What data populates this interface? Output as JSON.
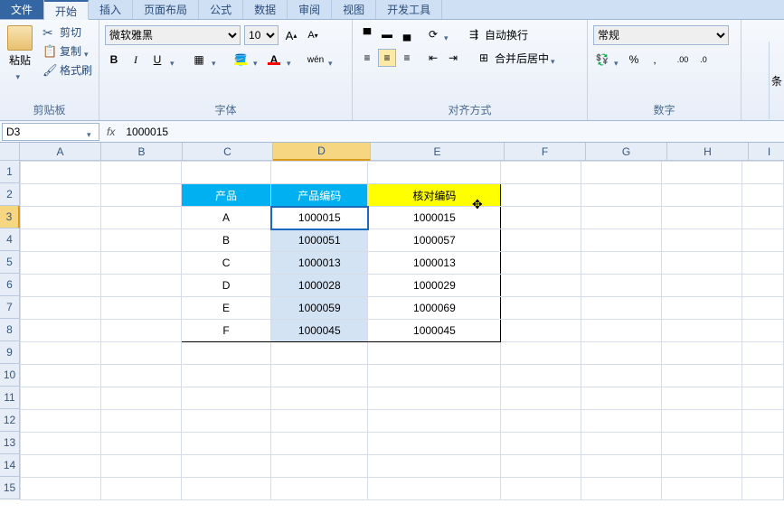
{
  "menu": {
    "file": "文件",
    "home": "开始",
    "insert": "插入",
    "layout": "页面布局",
    "formula": "公式",
    "data": "数据",
    "review": "审阅",
    "view": "视图",
    "dev": "开发工具"
  },
  "ribbon": {
    "clipboard": {
      "paste": "粘贴",
      "cut": "剪切",
      "copy": "复制",
      "format": "格式刷",
      "title": "剪贴板"
    },
    "font": {
      "name": "微软雅黑",
      "size": "10",
      "title": "字体"
    },
    "align": {
      "wrap": "自动换行",
      "merge": "合并后居中",
      "title": "对齐方式"
    },
    "number": {
      "format": "常规",
      "title": "数字"
    },
    "far_right": "条"
  },
  "formula_bar": {
    "namebox": "D3",
    "fx": "fx",
    "value": "1000015"
  },
  "cols": [
    "A",
    "B",
    "C",
    "D",
    "E",
    "F",
    "G",
    "H",
    "I"
  ],
  "rows": [
    "1",
    "2",
    "3",
    "4",
    "5",
    "6",
    "7",
    "8",
    "9",
    "10",
    "11",
    "12",
    "13",
    "14",
    "15"
  ],
  "active_cell": "D3",
  "table": {
    "headers": {
      "c": "产品",
      "d": "产品编码",
      "e": "核对编码"
    },
    "rows": [
      {
        "c": "A",
        "d": "1000015",
        "e": "1000015",
        "d_highlight": false
      },
      {
        "c": "B",
        "d": "1000051",
        "e": "1000057",
        "d_highlight": true
      },
      {
        "c": "C",
        "d": "1000013",
        "e": "1000013",
        "d_highlight": true
      },
      {
        "c": "D",
        "d": "1000028",
        "e": "1000029",
        "d_highlight": true
      },
      {
        "c": "E",
        "d": "1000059",
        "e": "1000069",
        "d_highlight": true
      },
      {
        "c": "F",
        "d": "1000045",
        "e": "1000045",
        "d_highlight": true
      }
    ]
  }
}
